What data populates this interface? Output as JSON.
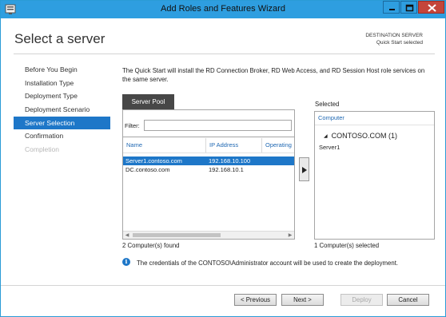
{
  "window": {
    "title": "Add Roles and Features Wizard"
  },
  "header": {
    "page_title": "Select a server",
    "destination_label": "DESTINATION SERVER",
    "destination_value": "Quick Start selected"
  },
  "nav": {
    "items": [
      {
        "label": "Before You Begin",
        "state": "normal"
      },
      {
        "label": "Installation Type",
        "state": "normal"
      },
      {
        "label": "Deployment Type",
        "state": "normal"
      },
      {
        "label": "Deployment Scenario",
        "state": "normal"
      },
      {
        "label": "Server Selection",
        "state": "active"
      },
      {
        "label": "Confirmation",
        "state": "normal"
      },
      {
        "label": "Completion",
        "state": "disabled"
      }
    ]
  },
  "main": {
    "intro": "The Quick Start will install the RD Connection Broker, RD Web Access, and RD Session Host role services on the same server.",
    "pool": {
      "tab_label": "Server Pool",
      "filter_label": "Filter:",
      "filter_value": "",
      "columns": [
        "Name",
        "IP Address",
        "Operating"
      ],
      "rows": [
        {
          "name": "Server1.contoso.com",
          "ip": "192.168.10.100",
          "selected": true
        },
        {
          "name": "DC.contoso.com",
          "ip": "192.168.10.1",
          "selected": false
        }
      ],
      "count_text": "2 Computer(s) found"
    },
    "selected": {
      "label": "Selected",
      "column": "Computer",
      "group_label": "CONTOSO.COM (1)",
      "items": [
        "Server1"
      ],
      "count_text": "1 Computer(s) selected"
    },
    "info_text": "The credentials of the CONTOSO\\Administrator account will be used to create the deployment."
  },
  "footer": {
    "previous_label": "< Previous",
    "next_label": "Next >",
    "deploy_label": "Deploy",
    "cancel_label": "Cancel"
  },
  "colors": {
    "titlebar": "#2e9ee0",
    "accent": "#1e77c8",
    "close_button": "#c4453a",
    "header_link": "#1f68b3"
  },
  "icons": {
    "app": "server-manager-icon",
    "minimize": "minimize-icon",
    "maximize": "maximize-icon",
    "close": "close-icon",
    "add": "right-arrow-icon",
    "info": "info-icon"
  }
}
